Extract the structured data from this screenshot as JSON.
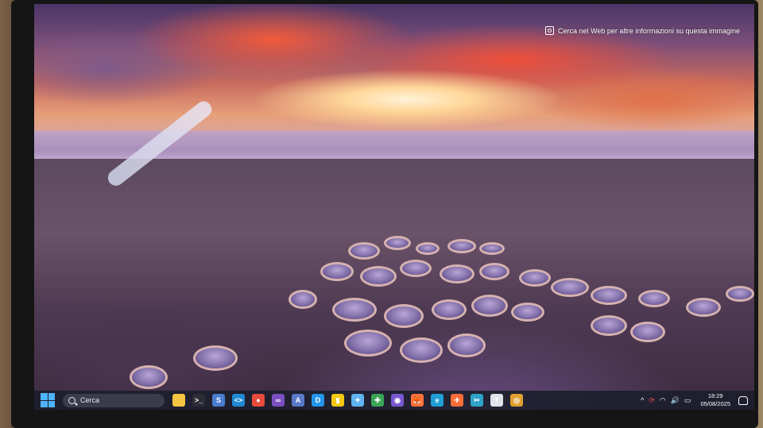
{
  "desktop": {
    "web_hint": "Cerca nel Web per altre informazioni su questa immagine"
  },
  "taskbar": {
    "search_placeholder": "Cerca",
    "apps": [
      {
        "name": "file-explorer-icon",
        "glyph": "",
        "color": "#f4c542"
      },
      {
        "name": "terminal-icon",
        "glyph": ">_",
        "color": "#2d2d36"
      },
      {
        "name": "sql-server-icon",
        "glyph": "S",
        "color": "#4a7cd1"
      },
      {
        "name": "vscode-icon",
        "glyph": "<>",
        "color": "#1f8ad2"
      },
      {
        "name": "chrome-icon",
        "glyph": "●",
        "color": "#e84b3c"
      },
      {
        "name": "visual-studio-icon",
        "glyph": "∞",
        "color": "#7b4fc2"
      },
      {
        "name": "azure-data-studio-icon",
        "glyph": "A",
        "color": "#5a7ac9"
      },
      {
        "name": "docker-icon",
        "glyph": "D",
        "color": "#2496ed"
      },
      {
        "name": "powerbi-icon",
        "glyph": "▮",
        "color": "#f2c811"
      },
      {
        "name": "copilot-icon",
        "glyph": "✦",
        "color": "#5fb3f0"
      },
      {
        "name": "app-icon-10",
        "glyph": "✚",
        "color": "#3aa655"
      },
      {
        "name": "github-desktop-icon",
        "glyph": "◉",
        "color": "#7a57d1"
      },
      {
        "name": "firefox-icon",
        "glyph": "🦊",
        "color": "#ff7139"
      },
      {
        "name": "edge-icon",
        "glyph": "e",
        "color": "#1f9ed8"
      },
      {
        "name": "postman-icon",
        "glyph": "✈",
        "color": "#ff6c37"
      },
      {
        "name": "snipping-tool-icon",
        "glyph": "✂",
        "color": "#2fa4c8"
      },
      {
        "name": "notepad-icon",
        "glyph": "T",
        "color": "#dde3ea"
      },
      {
        "name": "app-icon-17",
        "glyph": "◎",
        "color": "#e0a030"
      }
    ],
    "tray": {
      "chevron": "^",
      "time": "18:29",
      "date": "05/08/2025"
    }
  }
}
